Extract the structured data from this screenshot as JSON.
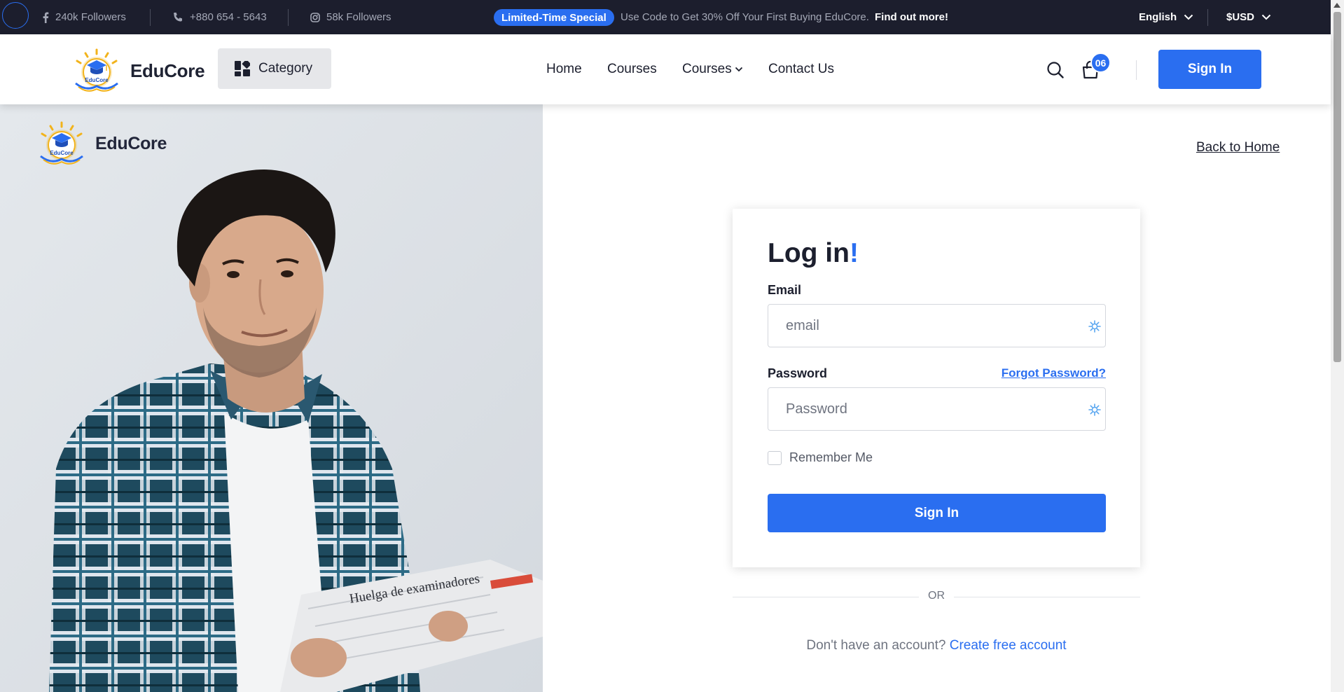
{
  "topbar": {
    "facebook": {
      "icon": "facebook-icon",
      "text": "240k Followers"
    },
    "phone": {
      "icon": "phone-icon",
      "text": "+880 654 - 5643"
    },
    "instagram": {
      "icon": "instagram-icon",
      "text": "58k Followers"
    },
    "promo_badge": "Limited-Time Special",
    "promo_text": "Use Code to Get 30% Off Your First Buying EduCore.",
    "promo_link": "Find out more!",
    "language": "English",
    "currency": "$USD"
  },
  "header": {
    "logo_mark_text": "EduCore",
    "logo_name": "EduCore",
    "category_label": "Category",
    "nav": [
      {
        "label": "Home"
      },
      {
        "label": "Courses"
      },
      {
        "label": "Courses",
        "has_dropdown": true
      },
      {
        "label": "Contact Us"
      }
    ],
    "cart_count": "06",
    "signin_label": "Sign In"
  },
  "panel": {
    "logo_mark_text": "EduCore",
    "logo_name": "EduCore",
    "newspaper_headline": "Huelga de examinadores"
  },
  "login": {
    "back_link": "Back to Home",
    "title": "Log in",
    "title_accent": "!",
    "email_label": "Email",
    "email_placeholder": "email",
    "password_label": "Password",
    "forgot_link": "Forgot Password?",
    "password_placeholder": "Password",
    "remember_label": "Remember Me",
    "remember_checked": false,
    "submit_label": "Sign In",
    "or_text": "OR",
    "signup_prompt": "Don't have an account?",
    "signup_link": "Create free account"
  },
  "colors": {
    "accent": "#2a6ef0",
    "topbar_bg": "#1c1e2d",
    "text_dark": "#1c1f2e"
  }
}
